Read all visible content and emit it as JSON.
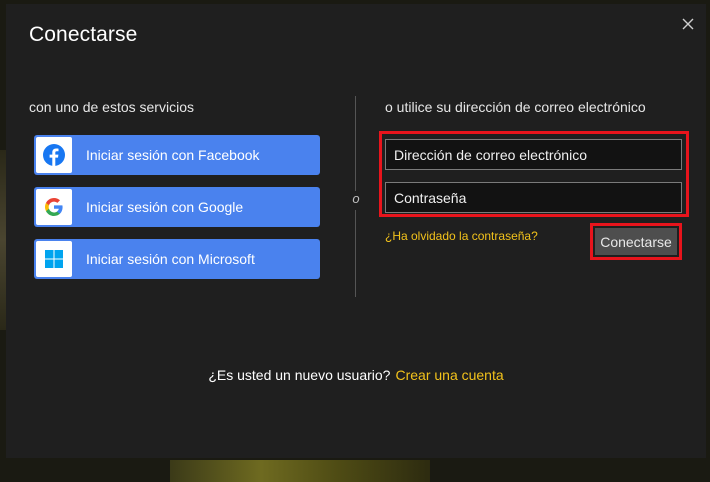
{
  "dialog": {
    "title": "Conectarse",
    "close_icon": "close-icon"
  },
  "social": {
    "heading": "con uno de estos servicios",
    "buttons": [
      {
        "label": "Iniciar sesión con Facebook",
        "icon": "facebook-icon",
        "color": "#1877f2"
      },
      {
        "label": "Iniciar sesión con Google",
        "icon": "google-icon"
      },
      {
        "label": "Iniciar sesión con Microsoft",
        "icon": "windows-icon",
        "color": "#00a4ef"
      }
    ],
    "button_color": "#4a82ee"
  },
  "separator": {
    "text": "o"
  },
  "email_login": {
    "heading": "o utilice su dirección de correo electrónico",
    "email_placeholder": "Dirección de correo electrónico",
    "password_placeholder": "Contraseña",
    "forgot_link": "¿Ha olvidado la contraseña?",
    "submit_label": "Conectarse",
    "highlight_color": "#e8141c",
    "link_color": "#f2c21b"
  },
  "footer": {
    "question": "¿Es usted un nuevo usuario?",
    "create_link": "Crear una cuenta"
  }
}
